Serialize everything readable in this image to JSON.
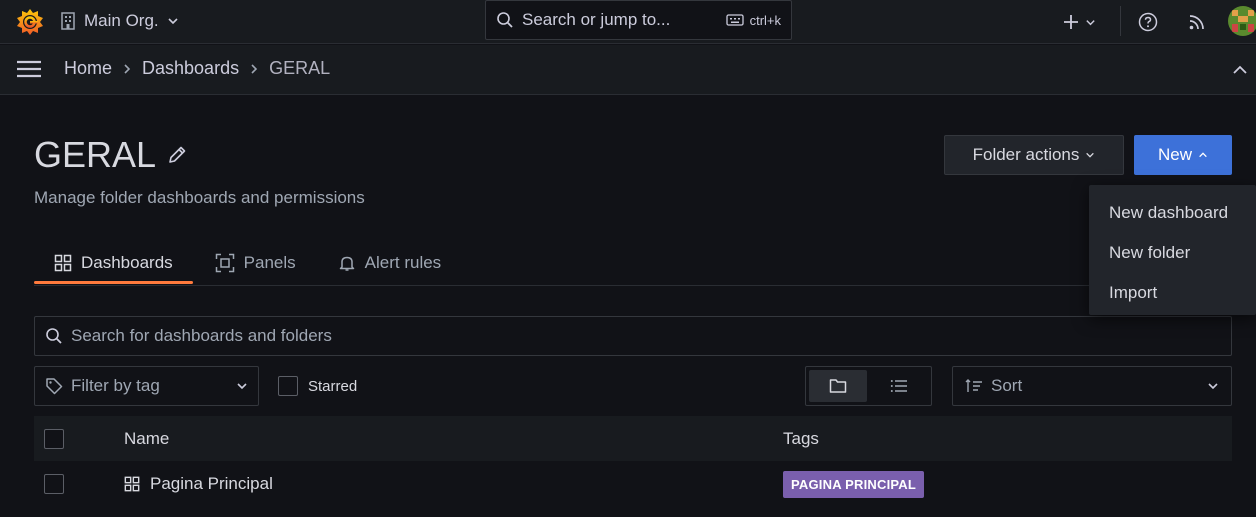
{
  "topbar": {
    "org_name": "Main Org.",
    "search_placeholder": "Search or jump to...",
    "search_shortcut": "ctrl+k"
  },
  "breadcrumb": {
    "items": [
      "Home",
      "Dashboards",
      "GERAL"
    ]
  },
  "page": {
    "title": "GERAL",
    "subtitle": "Manage folder dashboards and permissions",
    "folder_actions_label": "Folder actions",
    "new_label": "New"
  },
  "tabs": [
    {
      "label": "Dashboards",
      "active": true,
      "icon": "apps-icon"
    },
    {
      "label": "Panels",
      "active": false,
      "icon": "library-panel-icon"
    },
    {
      "label": "Alert rules",
      "active": false,
      "icon": "bell-icon"
    }
  ],
  "browse": {
    "search_placeholder": "Search for dashboards and folders",
    "tag_filter_placeholder": "Filter by tag",
    "starred_label": "Starred",
    "sort_placeholder": "Sort",
    "view_mode": "folder"
  },
  "table": {
    "columns": [
      "Name",
      "Tags"
    ],
    "rows": [
      {
        "name": "Pagina Principal",
        "tags": [
          "PAGINA PRINCIPAL"
        ]
      }
    ]
  },
  "new_menu": {
    "items": [
      "New dashboard",
      "New folder",
      "Import"
    ]
  },
  "colors": {
    "background": "#111217",
    "primary": "#3d71d9",
    "tab_accent": "#ff7a3d",
    "tag": "#7a5fad"
  }
}
